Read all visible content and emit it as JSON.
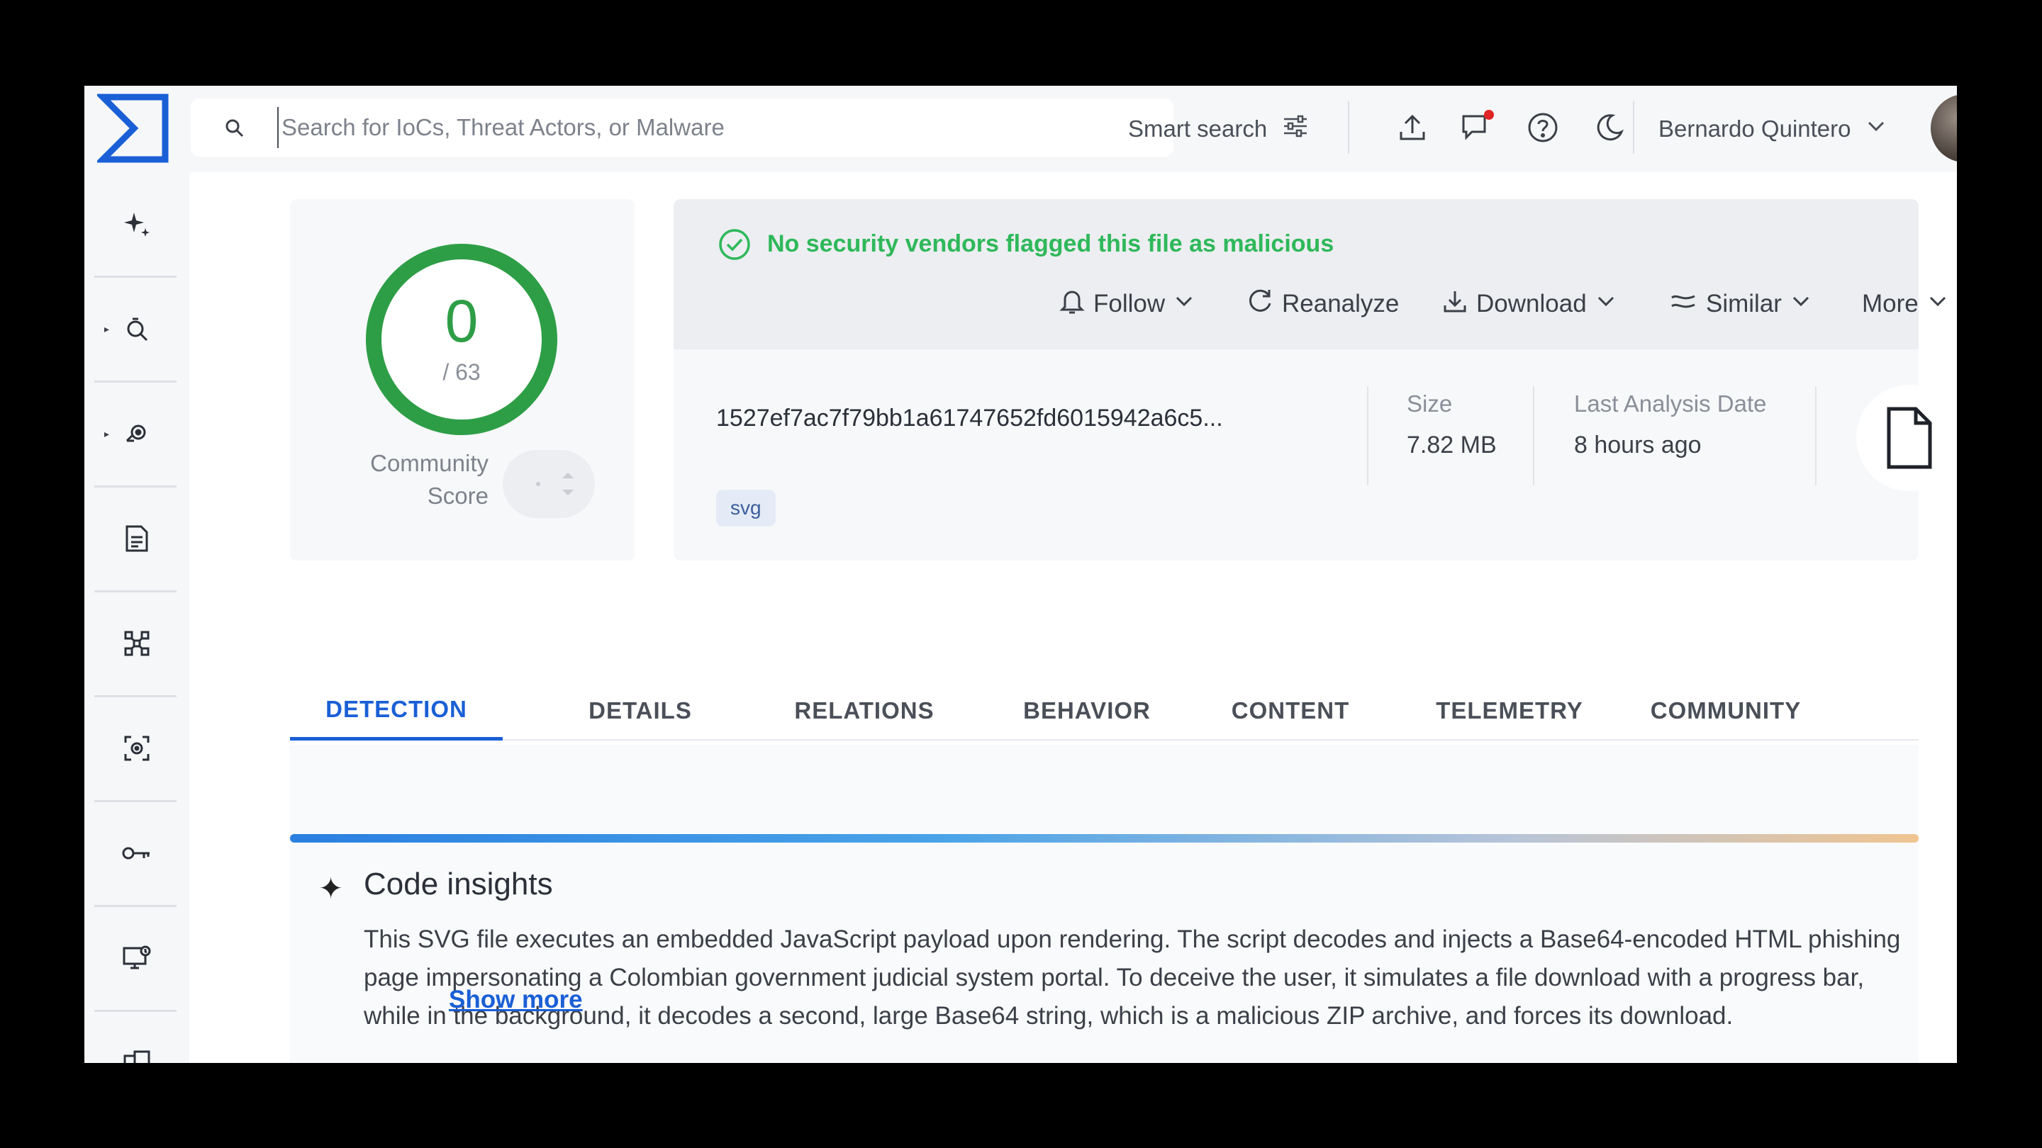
{
  "search": {
    "placeholder": "Search for IoCs, Threat Actors, or Malware"
  },
  "header": {
    "smart_search_label": "Smart search",
    "user_name": "Bernardo Quintero"
  },
  "score": {
    "detections": "0",
    "total": "/ 63",
    "community_label_line1": "Community",
    "community_label_line2": "Score"
  },
  "verdict": {
    "message": "No security vendors flagged this file as malicious"
  },
  "actions": {
    "follow": "Follow",
    "reanalyze": "Reanalyze",
    "download": "Download",
    "similar": "Similar",
    "more": "More"
  },
  "file": {
    "hash": "1527ef7ac7f79bb1a61747652fd6015942a6c5...",
    "tag": "svg",
    "size_label": "Size",
    "size_value": "7.82 MB",
    "date_label": "Last Analysis Date",
    "date_value": "8 hours ago"
  },
  "tabs": [
    "DETECTION",
    "DETAILS",
    "RELATIONS",
    "BEHAVIOR",
    "CONTENT",
    "TELEMETRY",
    "COMMUNITY"
  ],
  "insights": {
    "title": "Code insights",
    "body": "This SVG file executes an embedded JavaScript payload upon rendering. The script decodes and injects a Base64-encoded HTML phishing page impersonating a Colombian government judicial system portal. To deceive the user, it simulates a file download with a progress bar, while in the background, it decodes a second, large Base64 string, which is a malicious ZIP archive, and forces its download.",
    "show_more": "Show more"
  },
  "colors": {
    "accent": "#1a5fd6",
    "clean": "#2fb85a",
    "gauge": "#2e9e46",
    "notification": "#e02424"
  }
}
